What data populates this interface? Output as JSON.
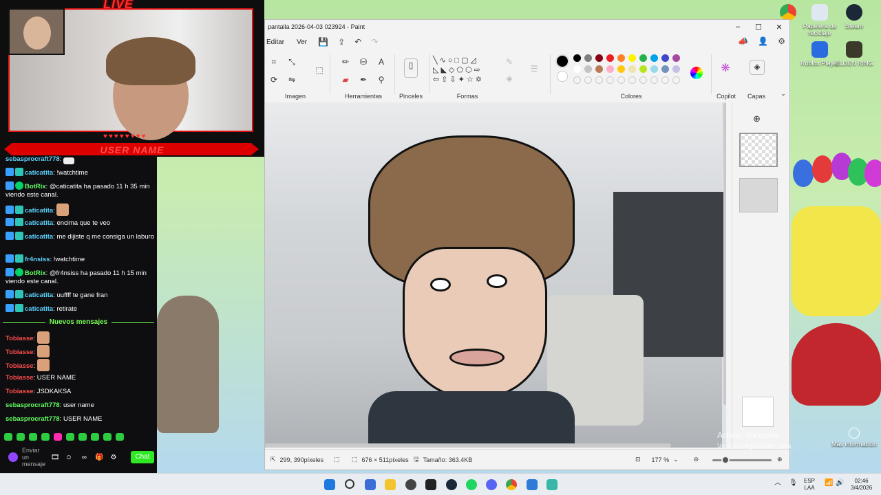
{
  "stream": {
    "live_label": "LIVE",
    "username_banner": "USER NAME",
    "hearts": "♥♥♥♥♥♥♥♥"
  },
  "chat": {
    "messages": [
      {
        "user": "sebasprocraft778",
        "text": ""
      },
      {
        "user": "caticatita",
        "text": "!watchtime"
      },
      {
        "user": "BotRix",
        "text": "@caticatita ha pasado 11 h 35 min viendo este canal."
      },
      {
        "user": "caticatita",
        "text": ""
      },
      {
        "user": "caticatita",
        "text": "encima que te veo"
      },
      {
        "user": "caticatita",
        "text": "me dijiste q me consiga un laburo"
      },
      {
        "user": "fr4nsiss",
        "text": "!watchtime"
      },
      {
        "user": "BotRix",
        "text": "@fr4nsiss ha pasado 11 h 15 min viendo este canal."
      },
      {
        "user": "caticatita",
        "text": "uuffff te gane fran"
      },
      {
        "user": "caticatita",
        "text": "retirate"
      }
    ],
    "new_messages_divider": "Nuevos mensajes",
    "new_messages": [
      {
        "user": "Tobiasse",
        "text": ""
      },
      {
        "user": "Tobiasse",
        "text": ""
      },
      {
        "user": "Tobiasse",
        "text": ""
      },
      {
        "user": "Tobiasse",
        "text": "USER NAME"
      },
      {
        "user": "Tobiasse",
        "text": "JSDKAKSA"
      },
      {
        "user": "sebasprocraft778",
        "text": "user name"
      },
      {
        "user": "sebasprocraft778",
        "text": "USER NAME"
      }
    ],
    "input_placeholder": "Enviar un mensaje",
    "send_label": "Chat"
  },
  "paint": {
    "title": "pantalla 2026-04-03 023924 - Paint",
    "menu": [
      "Editar",
      "Ver"
    ],
    "groups": {
      "image": "Imagen",
      "tools": "Herramientas",
      "brushes": "Pinceles",
      "shapes": "Formas",
      "colors": "Colores",
      "copilot": "Copilot",
      "layers": "Capas"
    },
    "colors": {
      "row1": [
        "#000000",
        "#7f7f7f",
        "#880015",
        "#ed1c24",
        "#ff7f27",
        "#fff200",
        "#22b14c",
        "#00a2e8",
        "#3f48cc",
        "#a349a4"
      ],
      "row2": [
        "#ffffff",
        "#c3c3c3",
        "#b97a57",
        "#ffaec9",
        "#ffc90e",
        "#efe4b0",
        "#b5e61d",
        "#99d9ea",
        "#7092be",
        "#c8bfe7"
      ]
    },
    "status": {
      "cursor": "299, 390píxeles",
      "dimensions": "676 × 511píxeles",
      "size": "Tamaño: 363.4KB",
      "zoom": "177 %"
    }
  },
  "desktop": {
    "icons": [
      "Papelera de reciclaje",
      "Steam",
      "Roblox Player",
      "ELDEN RING"
    ],
    "more_info": "Más información",
    "activate_title": "Activar Windows",
    "activate_sub": "Ve a Configuración para"
  },
  "taskbar": {
    "lang": "ESP",
    "layout": "LAA",
    "time": "02:46",
    "date": "3/4/2026"
  }
}
